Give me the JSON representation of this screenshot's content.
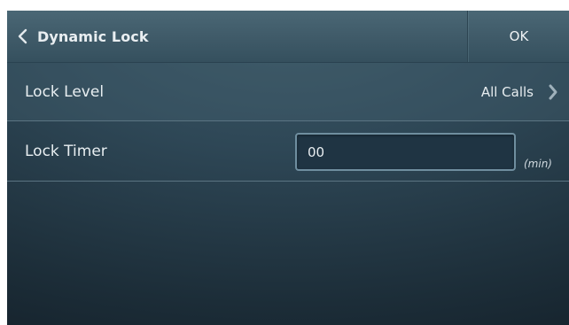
{
  "header": {
    "back_icon": "chevron-left-icon",
    "title": "Dynamic Lock",
    "ok_label": "OK"
  },
  "settings": {
    "lock_level": {
      "label": "Lock Level",
      "value": "All Calls",
      "icon": "chevron-right-icon"
    },
    "lock_timer": {
      "label": "Lock Timer",
      "value": "00",
      "unit": "(min)"
    }
  },
  "colors": {
    "background": "#2e4756",
    "header": "#3f5a68",
    "text": "#e9eef1",
    "input_border": "#6f8e9f",
    "input_background": "#1f3443",
    "divider": "#5b7482"
  }
}
